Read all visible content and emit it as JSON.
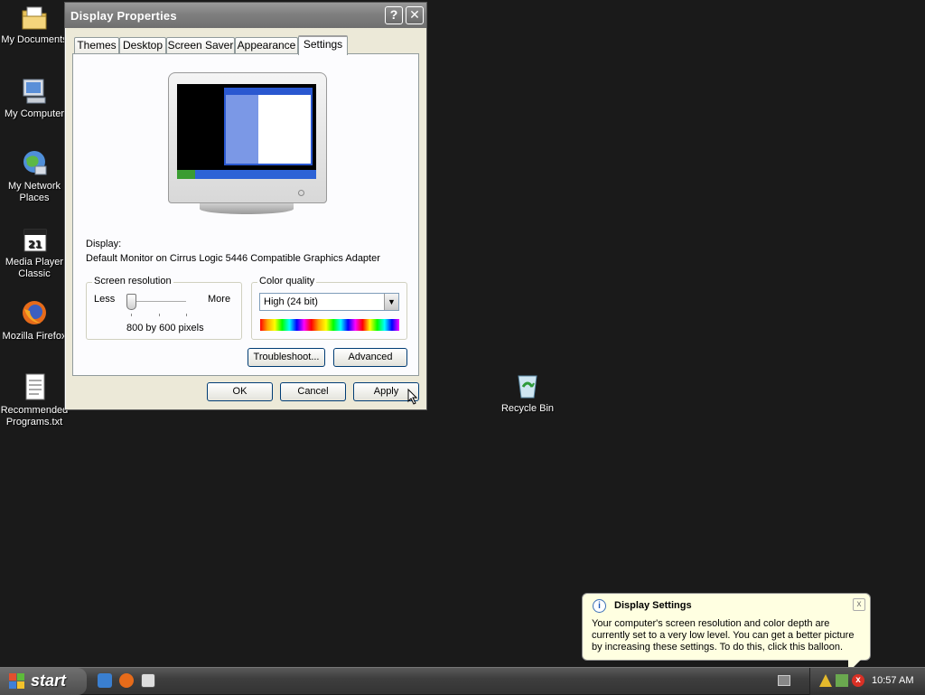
{
  "desktop": {
    "icons": [
      {
        "label": "My Documents"
      },
      {
        "label": "My Computer"
      },
      {
        "label": "My Network Places"
      },
      {
        "label": "Media Player Classic"
      },
      {
        "label": "Mozilla Firefox"
      },
      {
        "label": "Recommended Programs.txt"
      }
    ],
    "recycle_bin": "Recycle Bin"
  },
  "window": {
    "title": "Display Properties",
    "help_button": "?",
    "close_button": "✕",
    "tabs": [
      "Themes",
      "Desktop",
      "Screen Saver",
      "Appearance",
      "Settings"
    ],
    "active_tab": "Settings",
    "display_label": "Display:",
    "display_value": "Default Monitor on Cirrus Logic 5446 Compatible Graphics Adapter",
    "resolution": {
      "legend": "Screen resolution",
      "less": "Less",
      "more": "More",
      "value": "800 by 600 pixels"
    },
    "color_quality": {
      "legend": "Color quality",
      "selected": "High (24 bit)"
    },
    "buttons": {
      "troubleshoot": "Troubleshoot...",
      "advanced": "Advanced",
      "ok": "OK",
      "cancel": "Cancel",
      "apply": "Apply"
    }
  },
  "balloon": {
    "title": "Display Settings",
    "text": "Your computer's screen resolution and color depth are currently set to a very low level. You can get a better picture by increasing these settings. To do this, click this balloon.",
    "close": "x"
  },
  "taskbar": {
    "start_label": "start",
    "clock": "10:57 AM"
  }
}
